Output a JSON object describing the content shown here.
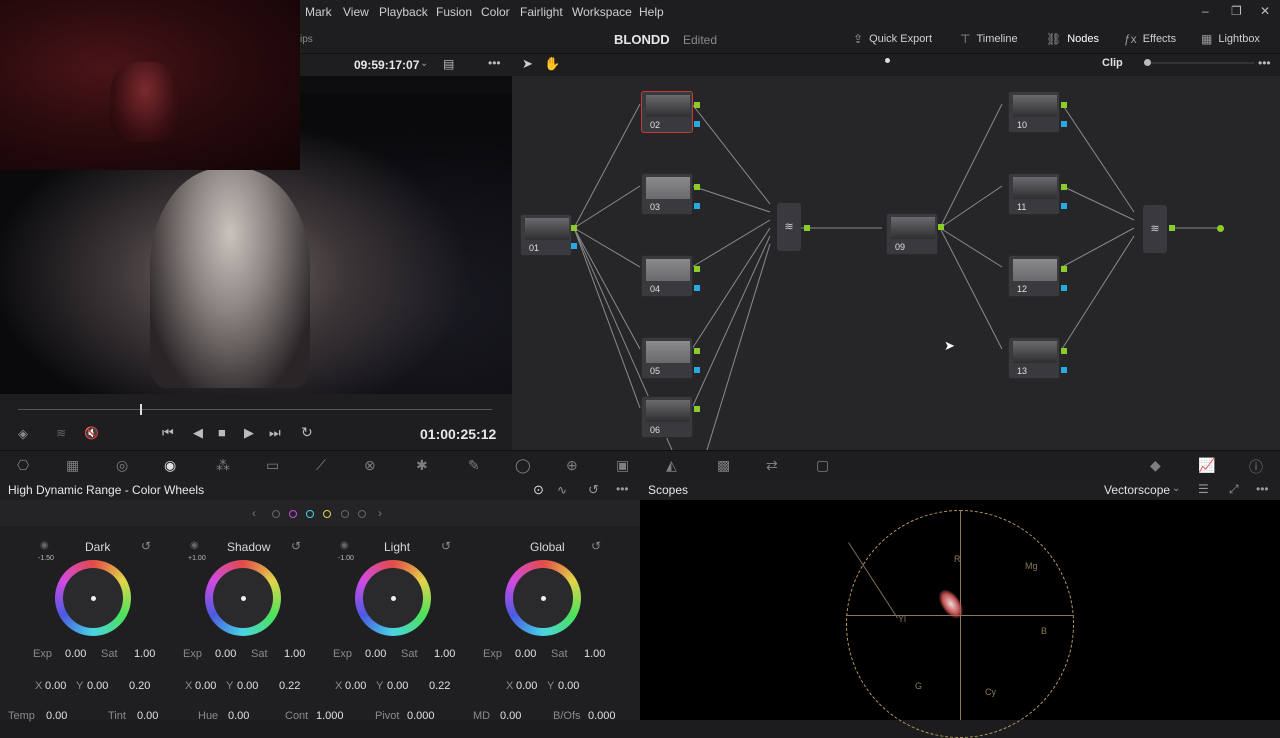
{
  "menubar": {
    "items": [
      "Mark",
      "View",
      "Playback",
      "Fusion",
      "Color",
      "Fairlight",
      "Workspace",
      "Help"
    ]
  },
  "toolbar": {
    "project_name": "BLONDD",
    "project_status": "Edited",
    "clips_label": "ips",
    "buttons": {
      "quick_export": "Quick Export",
      "timeline": "Timeline",
      "nodes": "Nodes",
      "effects": "Effects",
      "lightbox": "Lightbox"
    }
  },
  "viewer": {
    "source_timecode": "09:59:17:07",
    "record_timecode": "01:00:25:12"
  },
  "node_editor": {
    "mode": "Clip",
    "nodes": [
      "01",
      "02",
      "03",
      "04",
      "05",
      "06",
      "09",
      "10",
      "11",
      "12",
      "13"
    ]
  },
  "color_wheels": {
    "panel_title": "High Dynamic Range - Color Wheels",
    "wheels": [
      {
        "name": "Dark",
        "top_value": "-1.50",
        "exp": "0.00",
        "sat": "1.00",
        "x": "0.00",
        "y": "0.00",
        "z": "0.20"
      },
      {
        "name": "Shadow",
        "top_value": "+1.00",
        "exp": "0.00",
        "sat": "1.00",
        "x": "0.00",
        "y": "0.00",
        "z": "0.22"
      },
      {
        "name": "Light",
        "top_value": "-1.00",
        "exp": "0.00",
        "sat": "1.00",
        "x": "0.00",
        "y": "0.00",
        "z": "0.22"
      },
      {
        "name": "Global",
        "top_value": "",
        "exp": "0.00",
        "sat": "1.00",
        "x": "0.00",
        "y": "0.00",
        "z": ""
      }
    ],
    "labels": {
      "exp": "Exp",
      "sat": "Sat",
      "x": "X",
      "y": "Y"
    },
    "bottom_params": [
      {
        "label": "Temp",
        "value": "0.00"
      },
      {
        "label": "Tint",
        "value": "0.00"
      },
      {
        "label": "Hue",
        "value": "0.00"
      },
      {
        "label": "Cont",
        "value": "1.000"
      },
      {
        "label": "Pivot",
        "value": "0.000"
      },
      {
        "label": "MD",
        "value": "0.00"
      },
      {
        "label": "B/Ofs",
        "value": "0.000"
      }
    ]
  },
  "scopes": {
    "title": "Scopes",
    "mode": "Vectorscope",
    "targets": [
      "R",
      "Mg",
      "B",
      "Cy",
      "G",
      "Yl"
    ]
  },
  "accent": {
    "node_green": "#8ccc2a",
    "node_blue": "#2aa8e0",
    "selected_red": "#c23a3a"
  }
}
